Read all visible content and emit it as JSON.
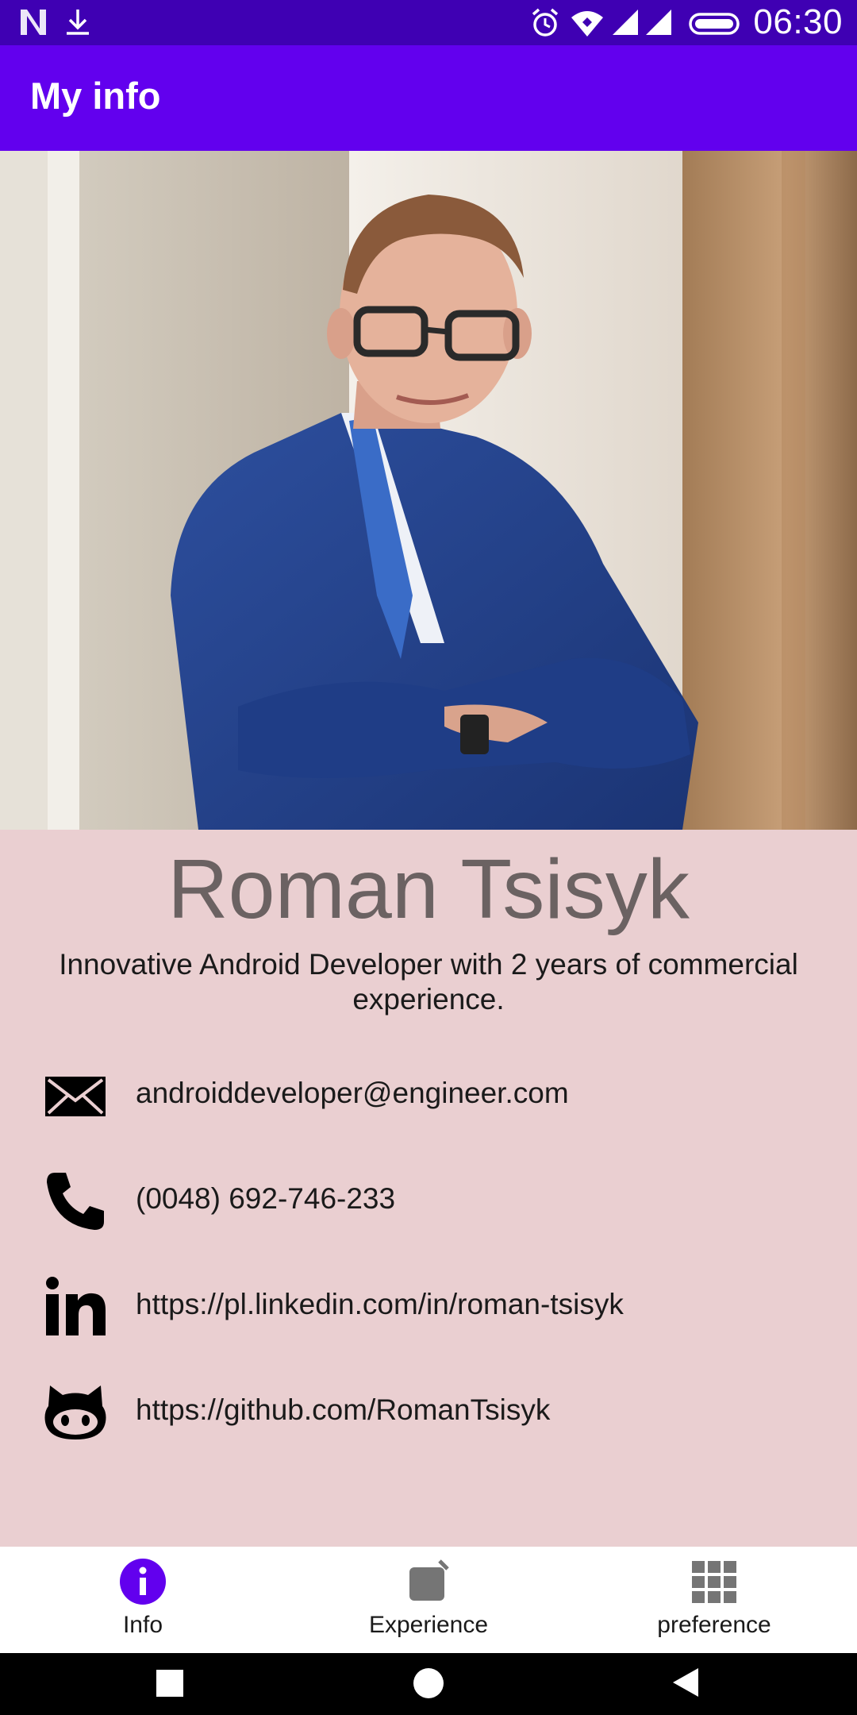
{
  "status_bar": {
    "time": "06:30",
    "icons": [
      "netflix-notification-icon",
      "download-icon",
      "alarm-icon",
      "wifi-icon",
      "signal-icon",
      "signal-icon",
      "battery-icon"
    ]
  },
  "app_bar": {
    "title": "My info"
  },
  "profile": {
    "name": "Roman Tsisyk",
    "tagline": "Innovative Android Developer with 2 years of commercial experience."
  },
  "contacts": [
    {
      "icon": "email-icon",
      "text": "androiddeveloper@engineer.com"
    },
    {
      "icon": "phone-icon",
      "text": "(0048) 692-746-233"
    },
    {
      "icon": "linkedin-icon",
      "text": "https://pl.linkedin.com/in/roman-tsisyk"
    },
    {
      "icon": "github-icon",
      "text": "https://github.com/RomanTsisyk"
    }
  ],
  "bottom_nav": {
    "items": [
      {
        "label": "Info",
        "icon": "info-icon",
        "active": true
      },
      {
        "label": "Experience",
        "icon": "experience-icon",
        "active": false
      },
      {
        "label": "preference",
        "icon": "grid-icon",
        "active": false
      }
    ]
  },
  "system_nav": {
    "buttons": [
      "recents-button",
      "home-button",
      "back-button"
    ]
  },
  "colors": {
    "status_bar": "#3f00b3",
    "app_bar": "#6200ee",
    "background": "#eacfd1",
    "active_nav": "#6200ee",
    "inactive_nav": "#757575"
  }
}
